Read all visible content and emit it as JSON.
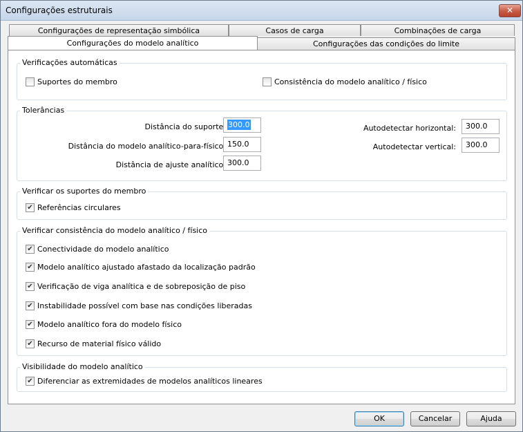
{
  "window": {
    "title": "Configurações estruturais",
    "close_symbol": "✕"
  },
  "tabs": {
    "row1": [
      "Configurações de representação simbólica",
      "Casos de carga",
      "Combinações de carga"
    ],
    "row2": [
      "Configurações do modelo analítico",
      "Configurações das condições do limite"
    ],
    "active": "Configurações do modelo analítico"
  },
  "auto_checks": {
    "title": "Verificações automáticas",
    "items": [
      {
        "label": "Suportes do membro",
        "checked": false
      },
      {
        "label": "Consistência do modelo analítico / físico",
        "checked": false
      }
    ]
  },
  "tolerances": {
    "title": "Tolerâncias",
    "support_distance": {
      "label": "Distância do suporte:",
      "value": "300.0"
    },
    "analytical_physical_distance": {
      "label": "Distância do modelo analítico-para-físico:",
      "value": "150.0"
    },
    "analytical_adjust_distance": {
      "label": "Distância de ajuste analítico:",
      "value": "300.0"
    },
    "auto_detect_horizontal": {
      "label": "Autodetectar horizontal:",
      "value": "300.0"
    },
    "auto_detect_vertical": {
      "label": "Autodetectar vertical:",
      "value": "300.0"
    }
  },
  "member_supports": {
    "title": "Verificar os suportes do membro",
    "items": [
      {
        "label": "Referências circulares",
        "checked": true
      }
    ]
  },
  "consistency": {
    "title": "Verificar consistência do modelo analítico / físico",
    "items": [
      {
        "label": "Conectividade do modelo analítico",
        "checked": true
      },
      {
        "label": "Modelo analítico ajustado afastado da localização padrão",
        "checked": true
      },
      {
        "label": "Verificação de viga analítica e de sobreposição de piso",
        "checked": true
      },
      {
        "label": "Instabilidade possível com base nas condições liberadas",
        "checked": true
      },
      {
        "label": "Modelo analítico fora do modelo físico",
        "checked": true
      },
      {
        "label": "Recurso de material físico válido",
        "checked": true
      }
    ]
  },
  "visibility": {
    "title": "Visibilidade do modelo analítico",
    "items": [
      {
        "label": "Diferenciar as extremidades de modelos analíticos lineares",
        "checked": true
      }
    ]
  },
  "buttons": {
    "ok": "OK",
    "cancel": "Cancelar",
    "help": "Ajuda"
  },
  "check_glyph": "✔"
}
